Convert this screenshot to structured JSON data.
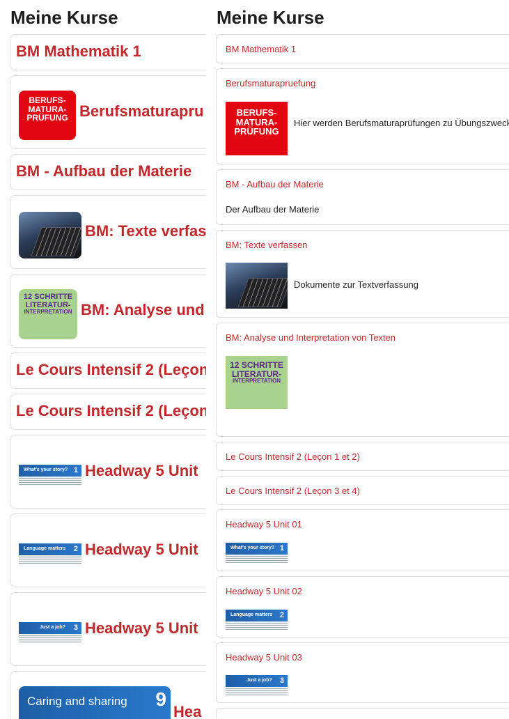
{
  "left": {
    "heading": "Meine Kurse",
    "courses": [
      {
        "title": "BM Mathematik 1"
      },
      {
        "title": "Berufsmaturapru"
      },
      {
        "title": "BM - Aufbau der Materie"
      },
      {
        "title": "BM: Texte verfas"
      },
      {
        "title": "BM: Analyse und"
      },
      {
        "title": "Le Cours Intensif 2 (Leçon"
      },
      {
        "title": "Le Cours Intensif 2 (Leçon"
      },
      {
        "title": "Headway 5 Unit"
      },
      {
        "title": "Headway 5 Unit"
      },
      {
        "title": "Headway 5 Unit"
      },
      {
        "title": "Hea"
      }
    ]
  },
  "right": {
    "heading": "Meine Kurse",
    "courses": [
      {
        "title": "BM Mathematik 1"
      },
      {
        "title": "Berufsmaturapruefung",
        "description": "Hier werden Berufsmaturaprüfungen zu Übungszweck"
      },
      {
        "title": "BM - Aufbau der Materie",
        "description": "Der Aufbau der Materie"
      },
      {
        "title": "BM: Texte verfassen",
        "description": "Dokumente zur Textverfassung"
      },
      {
        "title": "BM: Analyse und Interpretation von Texten"
      },
      {
        "title": "Le Cours Intensif 2 (Leçon 1 et 2)"
      },
      {
        "title": "Le Cours Intensif 2 (Leçon 3 et 4)"
      },
      {
        "title": "Headway 5 Unit 01"
      },
      {
        "title": "Headway 5 Unit 02"
      },
      {
        "title": "Headway 5 Unit 03"
      }
    ]
  },
  "images": {
    "berufsmatura": [
      "BERUFS-",
      "MATURA-",
      "PRÜFUNG"
    ],
    "literatur": [
      "12 SCHRITTE",
      "LITERATUR-",
      "INTERPRETATION"
    ],
    "headway1": {
      "caption": "What's your story?",
      "number": "1"
    },
    "headway2": {
      "caption": "Language matters",
      "number": "2"
    },
    "headway3": {
      "caption": "Just a job?",
      "number": "3"
    },
    "headway9": {
      "caption": "Caring and sharing",
      "number": "9"
    }
  },
  "colors": {
    "accent": "#c0282c",
    "heading": "#1d1d1d",
    "border": "#dddddd"
  }
}
